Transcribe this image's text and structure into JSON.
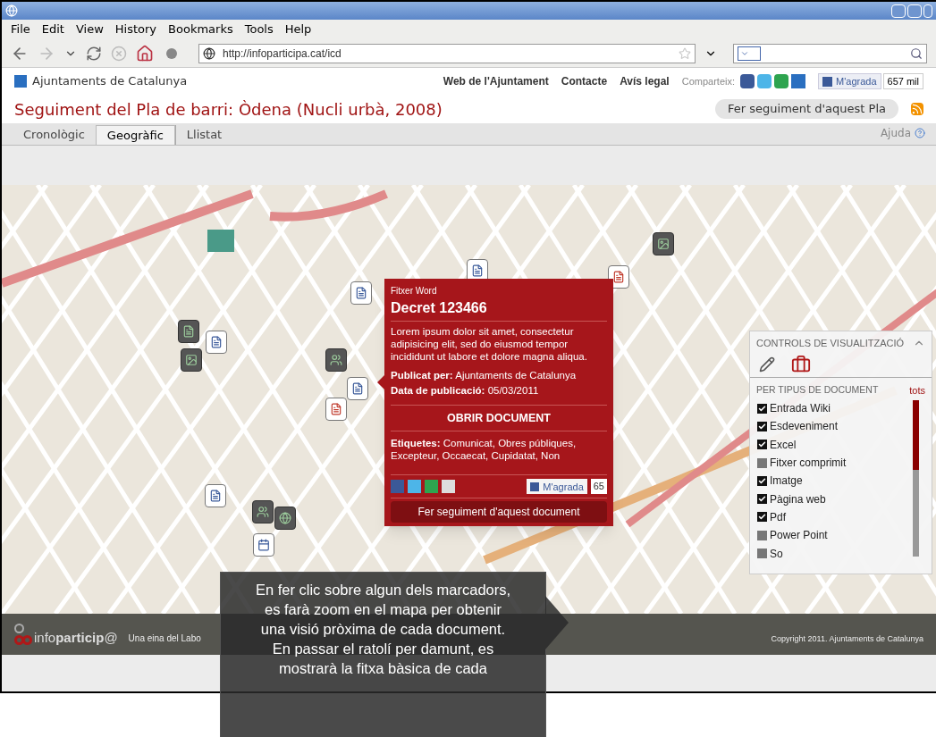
{
  "menu": [
    "File",
    "Edit",
    "View",
    "History",
    "Bookmarks",
    "Tools",
    "Help"
  ],
  "address": "http://infoparticipa.cat/icd",
  "site": {
    "name": "Ajuntaments de Catalunya",
    "links": [
      "Web de l'Ajuntament",
      "Contacte",
      "Avís legal"
    ],
    "share_label": "Comparteix:",
    "like": "M'agrada",
    "like_count": "657 mil"
  },
  "page_title": "Seguiment del Pla de barri: Òdena (Nucli urbà, 2008)",
  "follow_button": "Fer seguiment d'aquest Pla",
  "tabs": [
    {
      "label": "Cronològic",
      "selected": false
    },
    {
      "label": "Geogràfic",
      "selected": true
    },
    {
      "label": "Llistat",
      "selected": false
    }
  ],
  "help": "Ajuda",
  "popup": {
    "type": "Fitxer Word",
    "title": "Decret 123466",
    "description": "Lorem ipsum dolor sit amet, consectetur adipisicing elit, sed do eiusmod tempor incididunt ut labore et dolore magna aliqua.",
    "published_by": "**Publicat per:** Ajuntaments de Catalunya",
    "date": "**Data de publicació:** 05/03/2011",
    "open_button": "OBRIR DOCUMENT",
    "tags": "**Etiquetes:** Comunicat, Obres públiques, Excepteur, Occaecat, Cupidatat,  Non",
    "like": "M'agrada",
    "like_count": "65",
    "follow_button": "Fer seguiment d'aquest document"
  },
  "controls": {
    "title": "CONTROLS DE VISUALITZACIÓ",
    "section": "PER TIPUS DE DOCUMENT",
    "all": "tots",
    "items": [
      {
        "label": "Entrada Wiki",
        "checked": true
      },
      {
        "label": "Esdeveniment",
        "checked": true
      },
      {
        "label": "Excel",
        "checked": true
      },
      {
        "label": "Fitxer comprimit",
        "checked": false
      },
      {
        "label": "Imatge",
        "checked": true
      },
      {
        "label": "Pàgina web",
        "checked": true
      },
      {
        "label": "Pdf",
        "checked": true
      },
      {
        "label": "Power Point",
        "checked": false
      },
      {
        "label": "So",
        "checked": false
      }
    ]
  },
  "footer": {
    "brand": "info**particip**@",
    "credit": "Una eina del Labo",
    "copyright": "Copyright 2011. Ajuntaments de Catalunya"
  },
  "callout": "En fer clic sobre algun dels marcadors, es farà zoom en el mapa per obtenir una visió pròxima de cada document. En passar el ratolí per damunt, es mostrarà la fitxa bàsica de cada"
}
